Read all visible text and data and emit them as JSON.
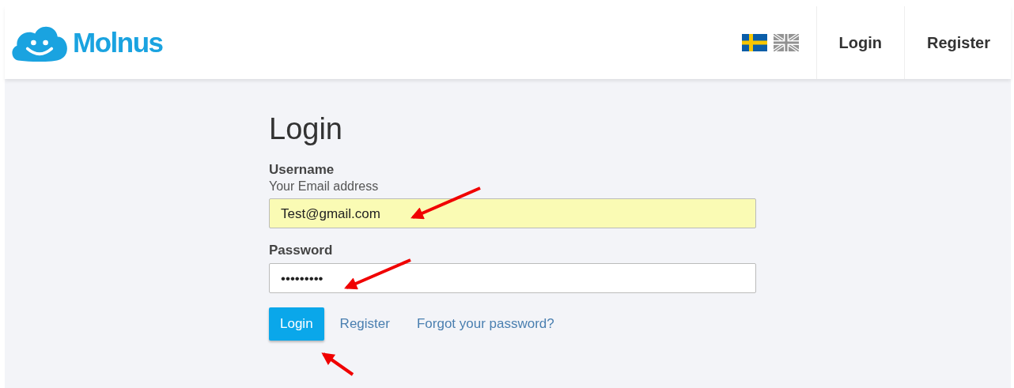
{
  "header": {
    "logo": "Molnus",
    "languages": [
      {
        "kind": "sweden",
        "selected": true
      },
      {
        "kind": "uk",
        "selected": false
      }
    ],
    "nav": [
      "Login",
      "Register"
    ]
  },
  "form": {
    "title": "Login",
    "fields": [
      {
        "label": "Username",
        "hint": "Your Email address",
        "value": "Test@gmail.com",
        "autofilled": true
      },
      {
        "label": "Password",
        "value": "•••••••••",
        "autofilled": false
      }
    ],
    "submit": "Login",
    "links": [
      "Register",
      "Forgot your password?"
    ]
  }
}
